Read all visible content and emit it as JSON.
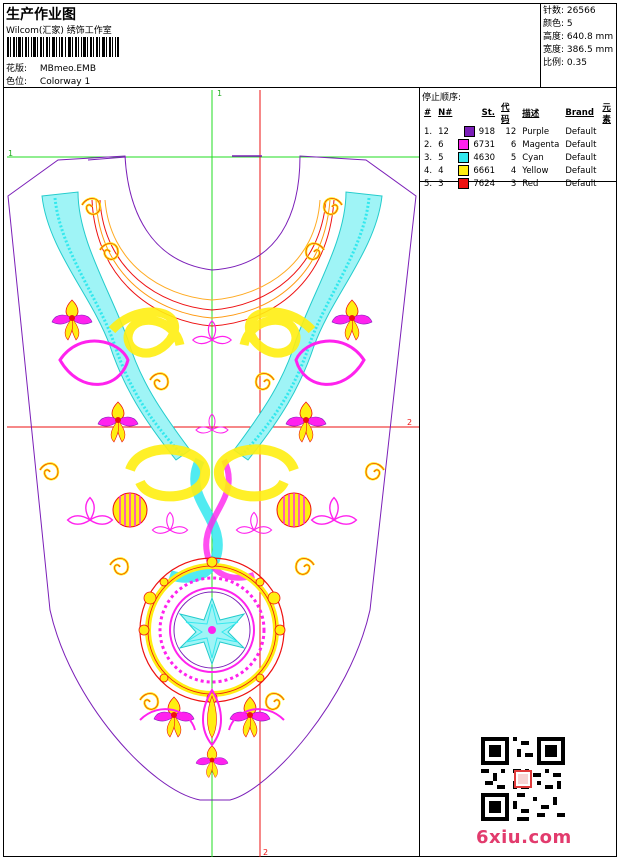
{
  "header": {
    "title": "生产作业图",
    "company": "Wilcom(汇家) 绣饰工作室",
    "design_label": "花版:",
    "design_value": "MBmeo.EMB",
    "colorway_label": "色位:",
    "colorway_value": "Colorway 1"
  },
  "stats": {
    "stitches_label": "针数:",
    "stitches_value": "26566",
    "colors_label": "颜色:",
    "colors_value": "5",
    "height_label": "高度:",
    "height_value": "640.8 mm",
    "width_label": "宽度:",
    "width_value": "386.5 mm",
    "scale_label": "比例:",
    "scale_value": "0.35"
  },
  "stop_sequence": {
    "title": "停止顺序:",
    "columns": [
      "#",
      "N#",
      "St.",
      "代码",
      "描述",
      "Brand",
      "元素"
    ],
    "rows": [
      {
        "idx": "1.",
        "n": "12",
        "st": "918",
        "code": "12",
        "desc": "Purple",
        "brand": "Default",
        "color": "#7b1fb8"
      },
      {
        "idx": "2.",
        "n": "6",
        "st": "6731",
        "code": "6",
        "desc": "Magenta",
        "brand": "Default",
        "color": "#ff22ee"
      },
      {
        "idx": "3.",
        "n": "5",
        "st": "4630",
        "code": "5",
        "desc": "Cyan",
        "brand": "Default",
        "color": "#33e8ee"
      },
      {
        "idx": "4.",
        "n": "4",
        "st": "6661",
        "code": "4",
        "desc": "Yellow",
        "brand": "Default",
        "color": "#ffee11"
      },
      {
        "idx": "5.",
        "n": "3",
        "st": "7624",
        "code": "3",
        "desc": "Red",
        "brand": "Default",
        "color": "#ee1111"
      }
    ]
  },
  "guides": {
    "v1": "1",
    "h1": "1",
    "h2": "2",
    "v2": "2"
  },
  "watermark": "6xiu.com",
  "colors": {
    "purple": "#7b1fb8",
    "magenta": "#ff22ee",
    "cyan": "#33e8ee",
    "yellow": "#ffee11",
    "red": "#ee1111",
    "guide_green": "#22dd22",
    "guide_red": "#ee1111"
  }
}
